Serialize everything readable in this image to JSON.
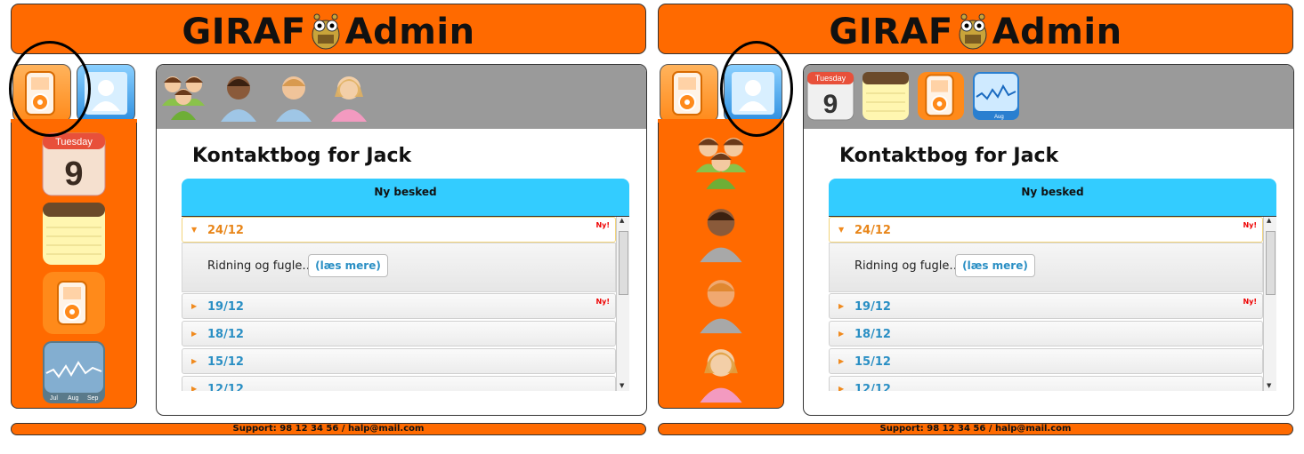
{
  "header": {
    "title_left": "GIRAF",
    "title_right": "Admin"
  },
  "content": {
    "heading": "Kontaktbog for Jack",
    "new_message_label": "Ny besked",
    "entries": [
      {
        "date": "24/12",
        "new": "Ny!",
        "preview": "Ridning og fugle…",
        "more_label": "(læs mere)"
      },
      {
        "date": "19/12",
        "new": "Ny!"
      },
      {
        "date": "18/12"
      },
      {
        "date": "15/12"
      },
      {
        "date": "12/12"
      }
    ]
  },
  "footer": {
    "support": "Support: 98 12 34 56 / halp@mail.com"
  },
  "calendar": {
    "weekday": "Tuesday",
    "day": "9"
  },
  "chart_icon_labels": [
    "Jul",
    "Aug",
    "Sep"
  ],
  "colors": {
    "orange": "#ff6a00",
    "blue": "#33ccff",
    "gray": "#9a9a9a"
  },
  "panels": [
    {
      "state": "apps-tab-selected",
      "toolbar_icons": [
        "group-icon",
        "boy-dark-icon",
        "boy-light-icon",
        "girl-icon"
      ],
      "sidebar_icons": [
        "calendar-icon",
        "notes-icon",
        "ipod-icon",
        "stocks-icon"
      ]
    },
    {
      "state": "contacts-tab-selected",
      "toolbar_icons": [
        "calendar-icon",
        "notes-icon",
        "ipod-icon",
        "stocks-icon"
      ],
      "sidebar_icons": [
        "group-icon",
        "boy-dark-icon",
        "boy-light-icon",
        "girl-icon"
      ]
    }
  ]
}
